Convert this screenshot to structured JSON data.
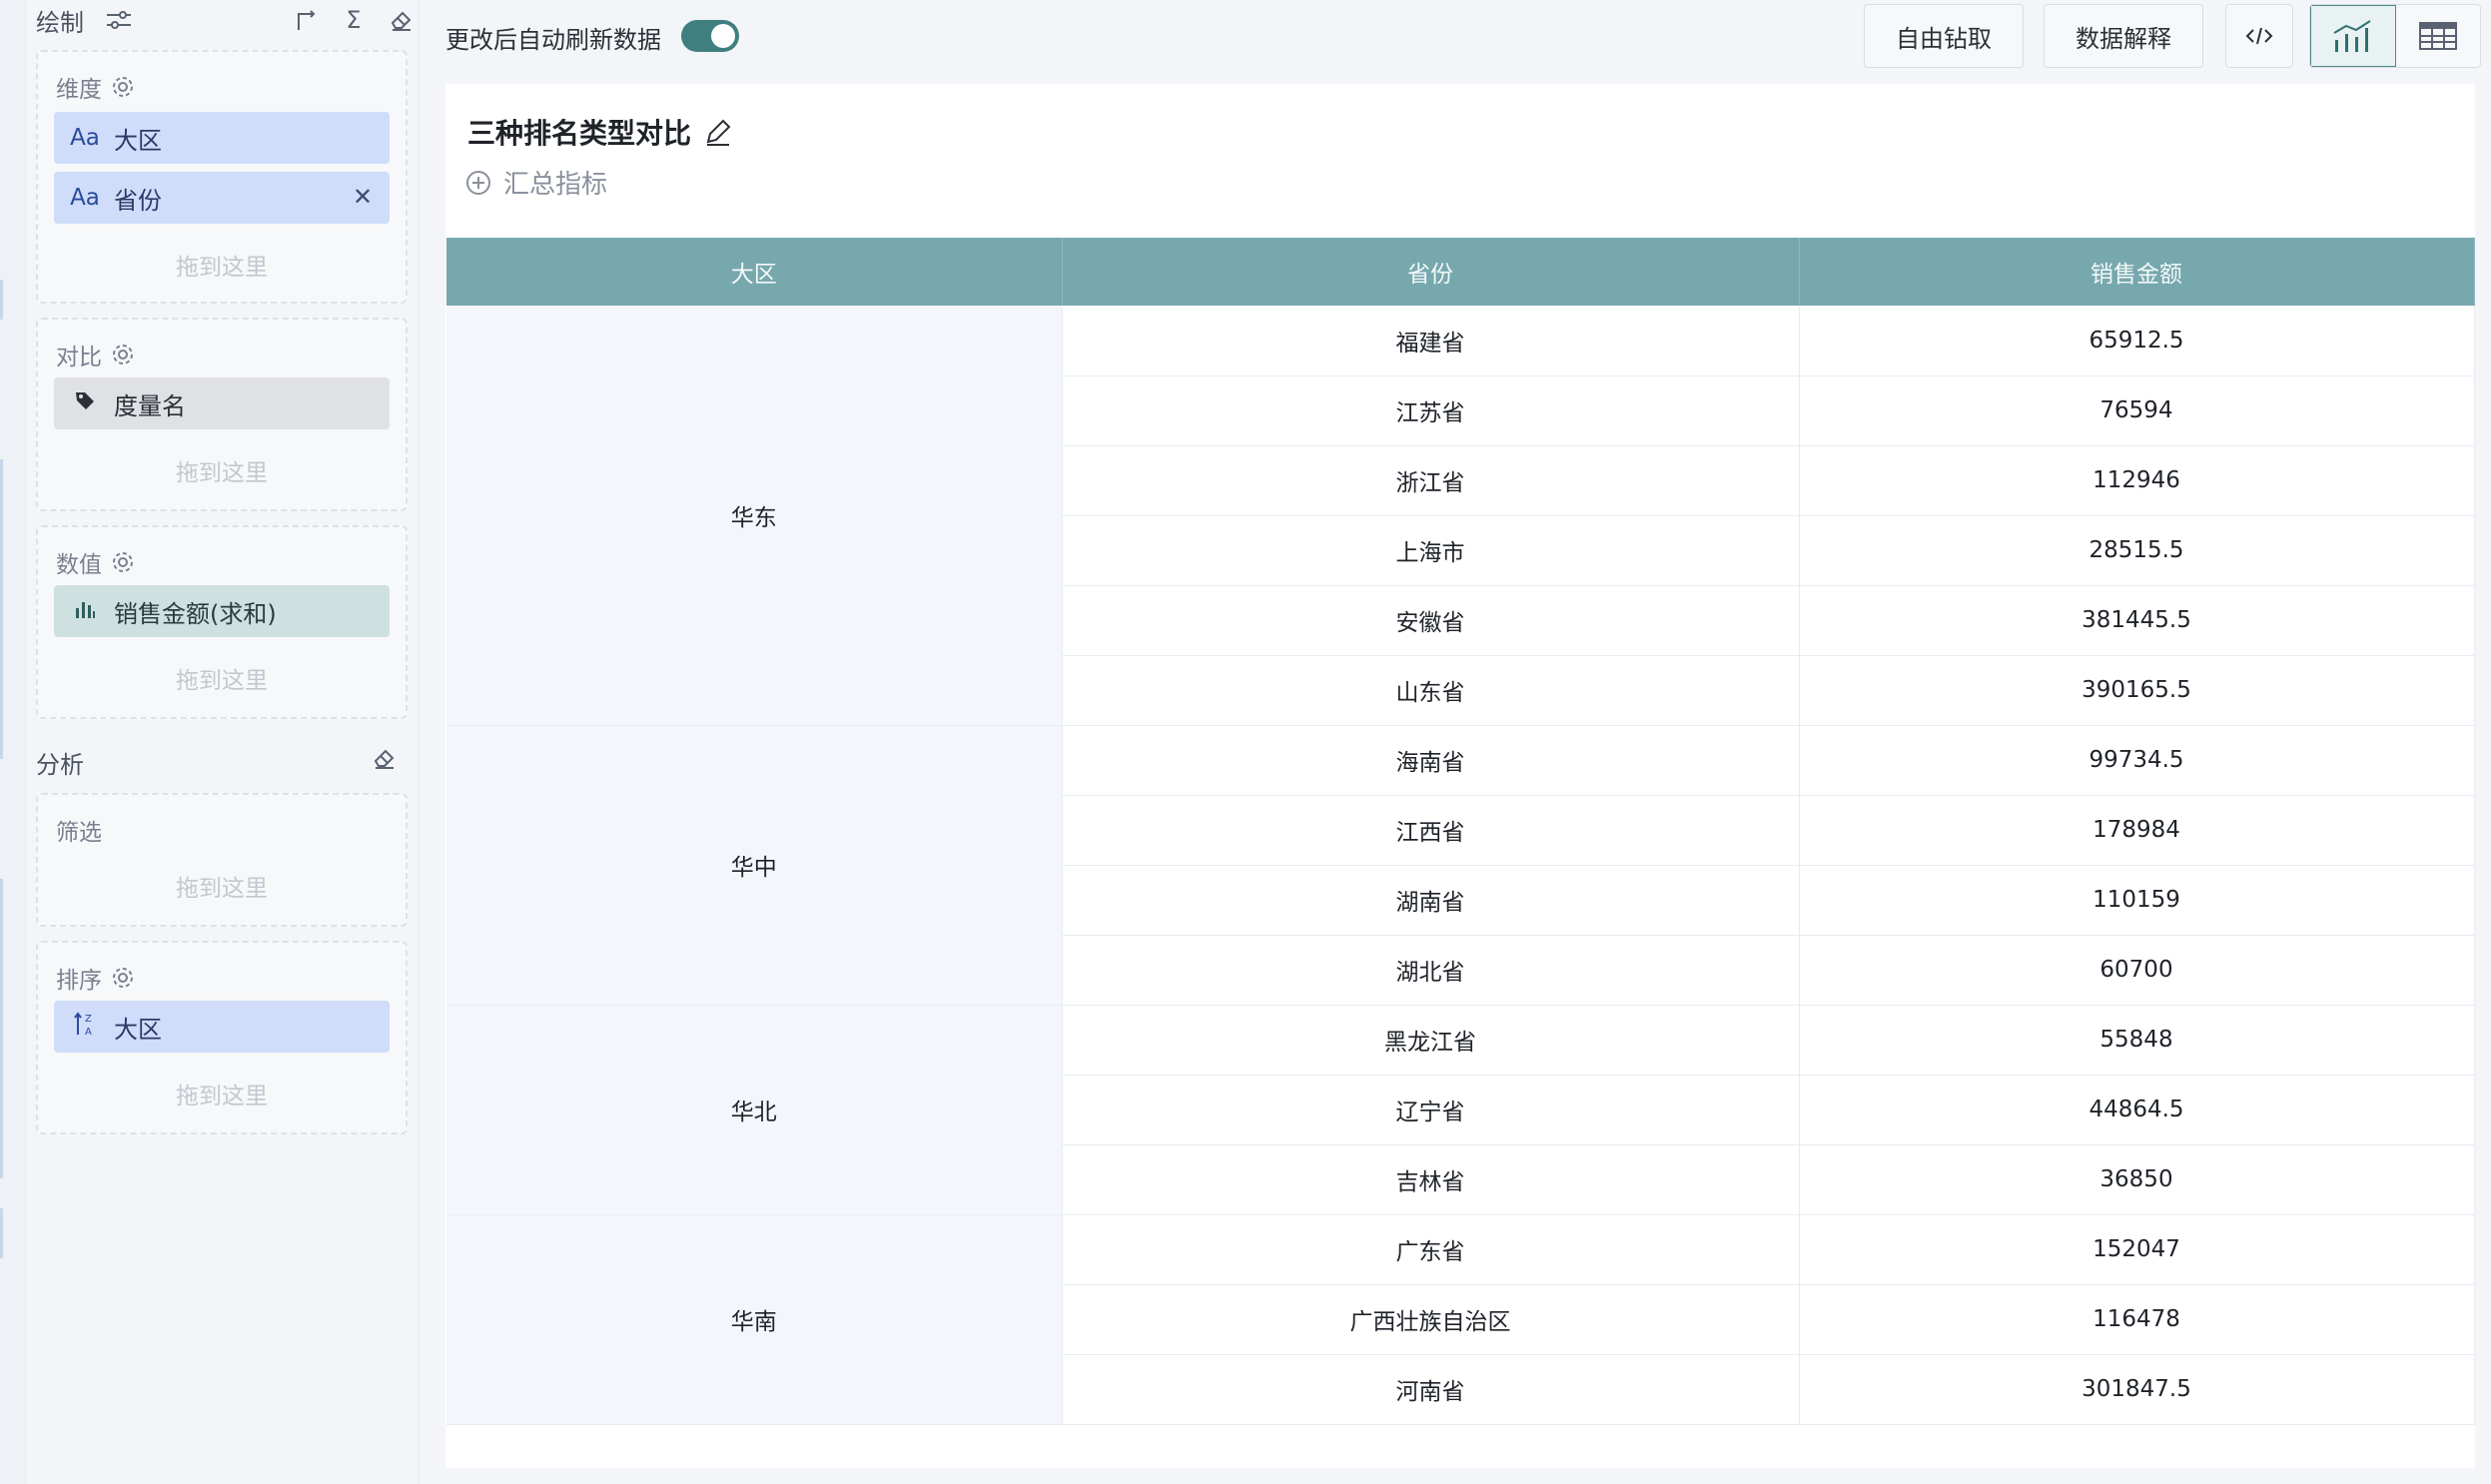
{
  "left_panel": {
    "header_title": "绘制",
    "dimension": {
      "label": "维度",
      "chips": [
        {
          "icon": "Aa",
          "text": "大区"
        },
        {
          "icon": "Aa",
          "text": "省份"
        }
      ],
      "drop_hint": "拖到这里"
    },
    "compare": {
      "label": "对比",
      "chips": [
        {
          "text": "度量名"
        }
      ],
      "drop_hint": "拖到这里"
    },
    "values": {
      "label": "数值",
      "chips": [
        {
          "text": "销售金额(求和)"
        }
      ],
      "drop_hint": "拖到这里"
    },
    "analysis_title": "分析",
    "filter": {
      "label": "筛选",
      "drop_hint": "拖到这里"
    },
    "sort": {
      "label": "排序",
      "chips": [
        {
          "text": "大区"
        }
      ],
      "drop_hint": "拖到这里"
    }
  },
  "topbar": {
    "auto_refresh_label": "更改后自动刷新数据",
    "auto_refresh_on": true,
    "drill_button": "自由钻取",
    "explain_button": "数据解释",
    "code_icon": "code-icon",
    "chart_view_icon": "chart-icon",
    "table_view_icon": "table-icon"
  },
  "card": {
    "title": "三种排名类型对比",
    "summary_label": "汇总指标"
  },
  "table": {
    "headers": [
      "大区",
      "省份",
      "销售金额"
    ],
    "groups": [
      {
        "region": "华东",
        "rows": [
          [
            "福建省",
            "65912.5"
          ],
          [
            "江苏省",
            "76594"
          ],
          [
            "浙江省",
            "112946"
          ],
          [
            "上海市",
            "28515.5"
          ],
          [
            "安徽省",
            "381445.5"
          ],
          [
            "山东省",
            "390165.5"
          ]
        ]
      },
      {
        "region": "华中",
        "rows": [
          [
            "海南省",
            "99734.5"
          ],
          [
            "江西省",
            "178984"
          ],
          [
            "湖南省",
            "110159"
          ],
          [
            "湖北省",
            "60700"
          ]
        ]
      },
      {
        "region": "华北",
        "rows": [
          [
            "黑龙江省",
            "55848"
          ],
          [
            "辽宁省",
            "44864.5"
          ],
          [
            "吉林省",
            "36850"
          ]
        ]
      },
      {
        "region": "华南",
        "rows": [
          [
            "广东省",
            "152047"
          ],
          [
            "广西壮族自治区",
            "116478"
          ],
          [
            "河南省",
            "301847.5"
          ]
        ]
      }
    ]
  },
  "colors": {
    "accent": "#3f7f7f",
    "header_bg": "#76a8ae",
    "chip_blue": "#cfdcfa"
  }
}
